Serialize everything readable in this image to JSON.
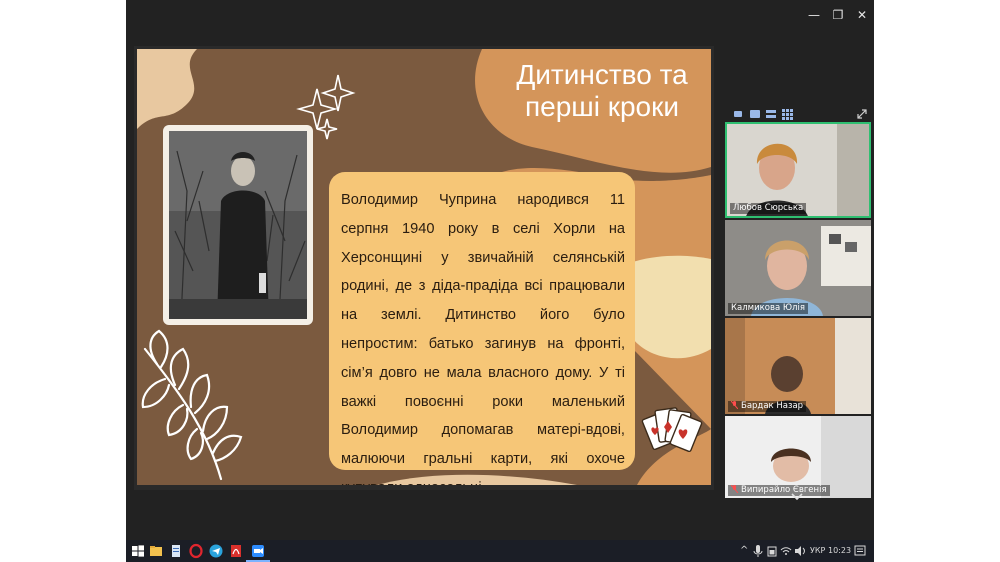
{
  "window": {
    "minimize": "—",
    "restore": "❐",
    "close": "✕"
  },
  "slide": {
    "title_line1": "Дитинство та",
    "title_line2": "перші кроки",
    "bio": "Володимир Чуприна народився 11 серпня 1940 року в селі Хорли на Херсонщині у звичайній селянській родині, де з діда-прадіда всі працювали на землі. Дитинство його було непростим: батько загинув на фронті, сім’я довго не мала власного дому. У ті важкі повоєнні роки маленький Володимир допомагав матері-вдові, малюючи гральні карти, які охоче купували односельці."
  },
  "participants": [
    {
      "name": "Любов Сюрська",
      "muted": false
    },
    {
      "name": "Калмикова Юлія",
      "muted": false
    },
    {
      "name": "Бардак Назар",
      "muted": true
    },
    {
      "name": "Випирайло Євгенія",
      "muted": true
    }
  ],
  "taskbar": {
    "language": "УКР",
    "time": "10:23",
    "caret": "^"
  },
  "colors": {
    "slide_brown": "#7b5a3f",
    "slide_tan": "#d4955a",
    "text_box": "#f6c677",
    "active_speaker": "#2fbf71"
  }
}
